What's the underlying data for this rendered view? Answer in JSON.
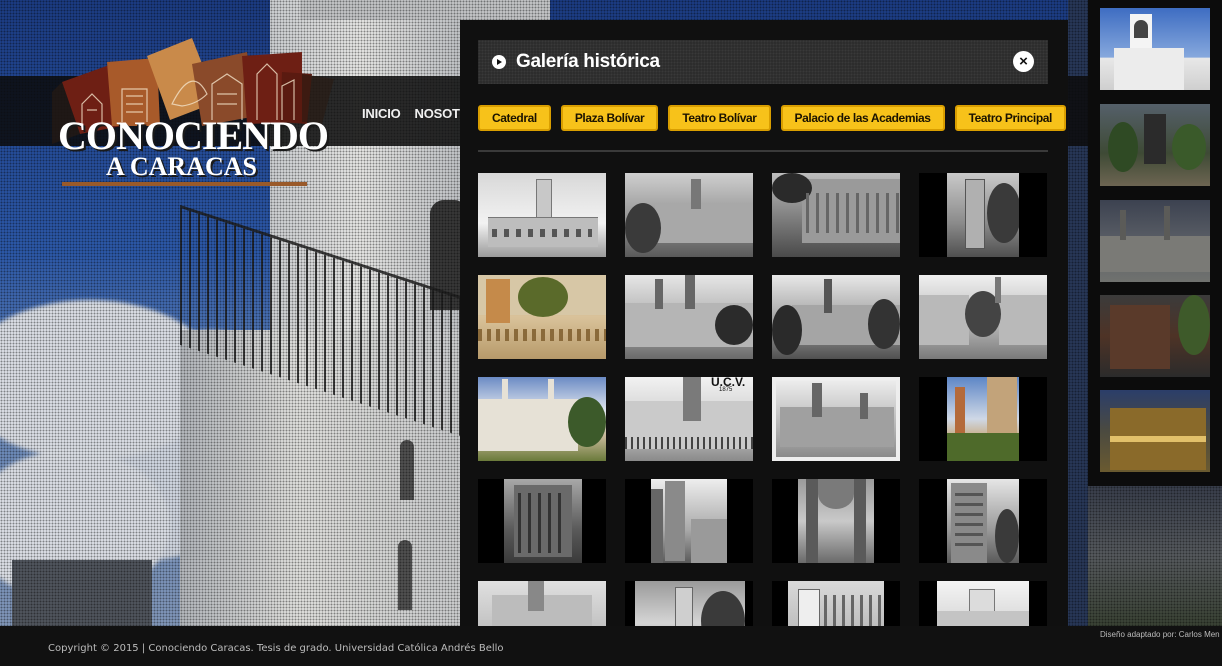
{
  "site": {
    "logo_line1": "CONOCIENDO",
    "logo_line2": "A CARACAS"
  },
  "nav": {
    "items": [
      "INICIO",
      "NOSOTROS"
    ]
  },
  "gallery": {
    "title": "Galería histórica",
    "close_icon": "close-icon",
    "tabs": [
      "Catedral",
      "Plaza Bolívar",
      "Teatro Bolívar",
      "Palacio de las Academias",
      "Teatro Principal"
    ]
  },
  "photo_labels": {
    "ucv": "U.C.V.",
    "ucv_year": "1875"
  },
  "footer": {
    "copyright": "Copyright © 2015 | Conociendo Caracas. Tesis de grado. Universidad Católica Andrés Bello",
    "credit": "Diseño adaptado por: Carlos Men"
  },
  "colors": {
    "tab_background": "#f7c21a",
    "modal_background": "#101010",
    "header_band": "#0c0c0c",
    "logo_brown": "#7a3e1c"
  }
}
